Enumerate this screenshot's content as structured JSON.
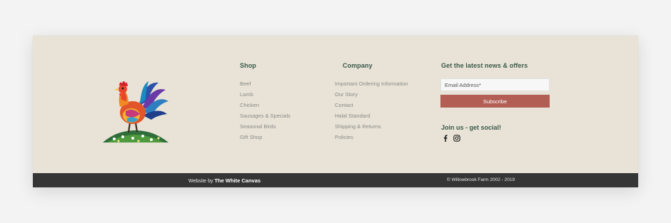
{
  "shop": {
    "heading": "Shop",
    "links": [
      "Beef",
      "Lamb",
      "Chicken",
      "Sausages & Specials",
      "Seasonal Birds",
      "Gift Shop"
    ]
  },
  "company": {
    "heading": "Company",
    "links": [
      "Important Ordering Information",
      "Our Story",
      "Contact",
      "Halal Standard",
      "Shipping & Returns",
      "Policies"
    ]
  },
  "newsletter": {
    "heading": "Get the latest news & offers",
    "email_placeholder": "Email Address*",
    "subscribe_label": "Subscribe"
  },
  "social": {
    "heading": "Join us - get social!",
    "icons": [
      "facebook-icon",
      "instagram-icon"
    ]
  },
  "bottom_bar": {
    "credit_prefix": "Website by",
    "credit_studio": "The White Canvas",
    "copyright": "© Willowbrook Farm 2002 - 2019"
  },
  "colors": {
    "footer_bg": "#e8e3d6",
    "heading": "#3b5a4c",
    "link": "#8a8a8a",
    "button": "#b35e55",
    "bottom_bar": "#353535"
  }
}
